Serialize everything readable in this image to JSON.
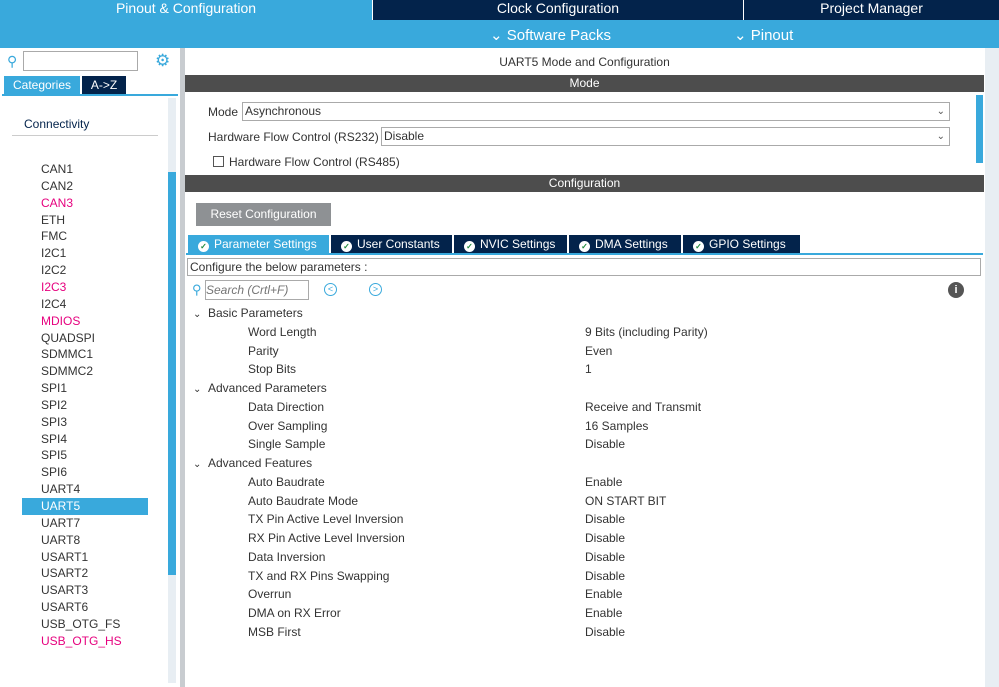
{
  "top_tabs": [
    "Pinout & Configuration",
    "Clock Configuration",
    "Project Manager"
  ],
  "sub_menu": [
    "Software Packs",
    "Pinout"
  ],
  "left": {
    "search_placeholder": "",
    "tabs": [
      "Categories",
      "A->Z"
    ],
    "category": "Connectivity",
    "items": [
      {
        "label": "CAN1",
        "pink": false
      },
      {
        "label": "CAN2",
        "pink": false
      },
      {
        "label": "CAN3",
        "pink": true
      },
      {
        "label": "ETH",
        "pink": false
      },
      {
        "label": "FMC",
        "pink": false
      },
      {
        "label": "I2C1",
        "pink": false
      },
      {
        "label": "I2C2",
        "pink": false
      },
      {
        "label": "I2C3",
        "pink": true
      },
      {
        "label": "I2C4",
        "pink": false
      },
      {
        "label": "MDIOS",
        "pink": true
      },
      {
        "label": "QUADSPI",
        "pink": false
      },
      {
        "label": "SDMMC1",
        "pink": false
      },
      {
        "label": "SDMMC2",
        "pink": false
      },
      {
        "label": "SPI1",
        "pink": false
      },
      {
        "label": "SPI2",
        "pink": false
      },
      {
        "label": "SPI3",
        "pink": false
      },
      {
        "label": "SPI4",
        "pink": false
      },
      {
        "label": "SPI5",
        "pink": false
      },
      {
        "label": "SPI6",
        "pink": false
      },
      {
        "label": "UART4",
        "pink": false
      },
      {
        "label": "UART5",
        "pink": false,
        "selected": true
      },
      {
        "label": "UART7",
        "pink": false
      },
      {
        "label": "UART8",
        "pink": false
      },
      {
        "label": "USART1",
        "pink": false
      },
      {
        "label": "USART2",
        "pink": false
      },
      {
        "label": "USART3",
        "pink": false
      },
      {
        "label": "USART6",
        "pink": false
      },
      {
        "label": "USB_OTG_FS",
        "pink": false
      },
      {
        "label": "USB_OTG_HS",
        "pink": true
      }
    ]
  },
  "main": {
    "title": "UART5 Mode and Configuration",
    "mode_header": "Mode",
    "mode_label": "Mode",
    "mode_value": "Asynchronous",
    "hfc_label": "Hardware Flow Control (RS232)",
    "hfc_value": "Disable",
    "rs485_label": "Hardware Flow Control (RS485)",
    "config_header": "Configuration",
    "reset_label": "Reset Configuration",
    "tabs": [
      "Parameter Settings",
      "User Constants",
      "NVIC Settings",
      "DMA Settings",
      "GPIO Settings"
    ],
    "configure_text": "Configure the below parameters :",
    "search_placeholder": "Search (Crtl+F)",
    "groups": [
      {
        "name": "Basic Parameters",
        "params": [
          [
            "Word Length",
            "9 Bits (including Parity)"
          ],
          [
            "Parity",
            "Even"
          ],
          [
            "Stop Bits",
            "1"
          ]
        ]
      },
      {
        "name": "Advanced Parameters",
        "params": [
          [
            "Data Direction",
            "Receive and Transmit"
          ],
          [
            "Over Sampling",
            "16 Samples"
          ],
          [
            "Single Sample",
            "Disable"
          ]
        ]
      },
      {
        "name": "Advanced Features",
        "params": [
          [
            "Auto Baudrate",
            "Enable"
          ],
          [
            "Auto Baudrate Mode",
            "ON START BIT"
          ],
          [
            "TX Pin Active Level Inversion",
            "Disable"
          ],
          [
            "RX Pin Active Level Inversion",
            "Disable"
          ],
          [
            "Data Inversion",
            "Disable"
          ],
          [
            "TX and RX Pins Swapping",
            "Disable"
          ],
          [
            "Overrun",
            "Enable"
          ],
          [
            "DMA on RX Error",
            "Enable"
          ],
          [
            "MSB First",
            "Disable"
          ]
        ]
      }
    ]
  }
}
